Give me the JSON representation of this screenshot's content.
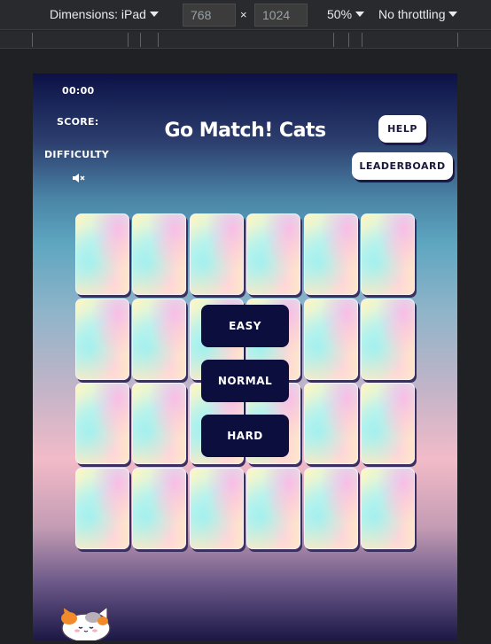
{
  "devtools": {
    "dimensions_label": "Dimensions: iPad",
    "width_value": "768",
    "height_value": "1024",
    "times_sign": "×",
    "zoom": "50%",
    "throttling": "No throttling"
  },
  "game": {
    "timer": "00:00",
    "score_label": "SCORE:",
    "difficulty_label": "DIFFICULTY",
    "title": "Go Match! Cats",
    "help_label": "HELP",
    "leaderboard_label": "LEADERBOARD",
    "difficulty_options": [
      "EASY",
      "NORMAL",
      "HARD"
    ],
    "card_rows": 4,
    "card_cols": 6
  },
  "icons": [
    "dropdown-caret-icon",
    "mute-speaker-icon",
    "cat-mascot-icon"
  ],
  "colors": {
    "difficulty_button_bg": "#0c0f3e",
    "white_button_bg": "#ffffff",
    "devtools_bg": "#292a2d"
  }
}
